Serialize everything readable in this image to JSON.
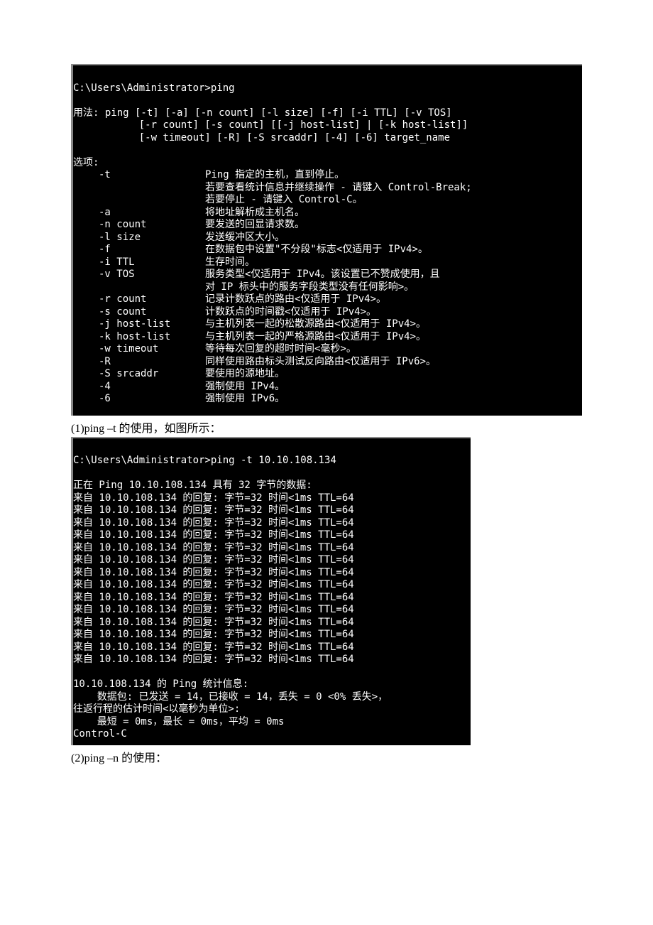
{
  "term1": {
    "prompt": "C:\\Users\\Administrator>ping",
    "usage1": "用法: ping [-t] [-a] [-n count] [-l size] [-f] [-i TTL] [-v TOS]",
    "usage2": "           [-r count] [-s count] [[-j host-list] | [-k host-list]]",
    "usage3": "           [-w timeout] [-R] [-S srcaddr] [-4] [-6] target_name",
    "options_label": "选项:",
    "opts": [
      {
        "flag": "-t",
        "desc": "Ping 指定的主机，直到停止。"
      },
      {
        "flag": "",
        "desc": "若要查看统计信息并继续操作 - 请键入 Control-Break;"
      },
      {
        "flag": "",
        "desc": "若要停止 - 请键入 Control-C。"
      },
      {
        "flag": "-a",
        "desc": "将地址解析成主机名。"
      },
      {
        "flag": "-n count",
        "desc": "要发送的回显请求数。"
      },
      {
        "flag": "-l size",
        "desc": "发送缓冲区大小。"
      },
      {
        "flag": "-f",
        "desc": "在数据包中设置\"不分段\"标志<仅适用于 IPv4>。"
      },
      {
        "flag": "-i TTL",
        "desc": "生存时间。"
      },
      {
        "flag": "-v TOS",
        "desc": "服务类型<仅适用于 IPv4。该设置已不赞成使用，且"
      },
      {
        "flag": "",
        "desc": "对 IP 标头中的服务字段类型没有任何影响>。"
      },
      {
        "flag": "-r count",
        "desc": "记录计数跃点的路由<仅适用于 IPv4>。"
      },
      {
        "flag": "-s count",
        "desc": "计数跃点的时间戳<仅适用于 IPv4>。"
      },
      {
        "flag": "-j host-list",
        "desc": "与主机列表一起的松散源路由<仅适用于 IPv4>。"
      },
      {
        "flag": "-k host-list",
        "desc": "与主机列表一起的严格源路由<仅适用于 IPv4>。"
      },
      {
        "flag": "-w timeout",
        "desc": "等待每次回复的超时时间<毫秒>。"
      },
      {
        "flag": "-R",
        "desc": "同样使用路由标头测试反向路由<仅适用于 IPv6>。"
      },
      {
        "flag": "-S srcaddr",
        "desc": "要使用的源地址。"
      },
      {
        "flag": "-4",
        "desc": "强制使用 IPv4。"
      },
      {
        "flag": "-6",
        "desc": "强制使用 IPv6。"
      }
    ]
  },
  "caption1": "(1)ping –t 的使用，如图所示：",
  "term2": {
    "prompt": "C:\\Users\\Administrator>ping -t 10.10.108.134",
    "hdr": "正在 Ping 10.10.108.134 具有 32 字节的数据:",
    "reply": "来自 10.10.108.134 的回复: 字节=32 时间<1ms TTL=64",
    "reply_count": 14,
    "stats_title": "10.10.108.134 的 Ping 统计信息:",
    "stats1": "    数据包: 已发送 = 14，已接收 = 14，丢失 = 0 <0% 丢失>，",
    "stats2": "往返行程的估计时间<以毫秒为单位>:",
    "stats3": "    最短 = 0ms，最长 = 0ms，平均 = 0ms",
    "ctrl": "Control-C"
  },
  "caption2": "(2)ping –n 的使用："
}
